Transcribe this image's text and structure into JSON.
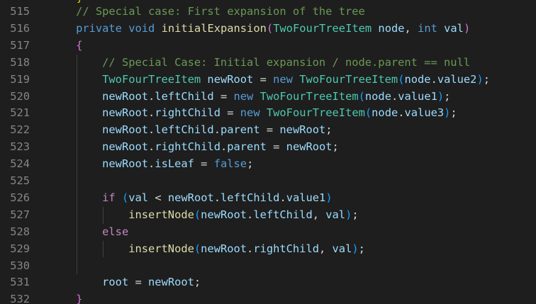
{
  "editor": {
    "theme_colors": {
      "background": "#1e1e1e",
      "line_number": "#858585",
      "comment": "#6a9955",
      "keyword": "#569cd6",
      "control": "#c586c0",
      "type": "#4ec9b0",
      "function": "#dcdcaa",
      "variable": "#9cdcfe",
      "text": "#d4d4d4"
    },
    "lines": [
      {
        "number": "515",
        "indent": "    ",
        "tokens": [
          {
            "t": "// Special case: First expansion of the tree",
            "c": "comment"
          }
        ]
      },
      {
        "number": "516",
        "indent": "    ",
        "tokens": [
          {
            "t": "private",
            "c": "keyword"
          },
          {
            "t": " ",
            "c": "plain"
          },
          {
            "t": "void",
            "c": "keyword"
          },
          {
            "t": " ",
            "c": "plain"
          },
          {
            "t": "initialExpansion",
            "c": "func"
          },
          {
            "t": "(",
            "c": "brace"
          },
          {
            "t": "TwoFourTreeItem",
            "c": "type"
          },
          {
            "t": " ",
            "c": "plain"
          },
          {
            "t": "node",
            "c": "var"
          },
          {
            "t": ", ",
            "c": "plain"
          },
          {
            "t": "int",
            "c": "keyword"
          },
          {
            "t": " ",
            "c": "plain"
          },
          {
            "t": "val",
            "c": "var"
          },
          {
            "t": ")",
            "c": "brace"
          }
        ]
      },
      {
        "number": "517",
        "indent": "    ",
        "tokens": [
          {
            "t": "{",
            "c": "brace"
          }
        ]
      },
      {
        "number": "518",
        "indent": "        ",
        "tokens": [
          {
            "t": "// Special Case: Initial expansion / node.parent == null",
            "c": "comment"
          }
        ]
      },
      {
        "number": "519",
        "indent": "        ",
        "tokens": [
          {
            "t": "TwoFourTreeItem",
            "c": "type"
          },
          {
            "t": " ",
            "c": "plain"
          },
          {
            "t": "newRoot",
            "c": "var"
          },
          {
            "t": " = ",
            "c": "plain"
          },
          {
            "t": "new",
            "c": "keyword"
          },
          {
            "t": " ",
            "c": "plain"
          },
          {
            "t": "TwoFourTreeItem",
            "c": "type"
          },
          {
            "t": "(",
            "c": "brace2"
          },
          {
            "t": "node",
            "c": "var"
          },
          {
            "t": ".",
            "c": "plain"
          },
          {
            "t": "value2",
            "c": "var"
          },
          {
            "t": ")",
            "c": "brace2"
          },
          {
            "t": ";",
            "c": "plain"
          }
        ]
      },
      {
        "number": "520",
        "indent": "        ",
        "tokens": [
          {
            "t": "newRoot",
            "c": "var"
          },
          {
            "t": ".",
            "c": "plain"
          },
          {
            "t": "leftChild",
            "c": "var"
          },
          {
            "t": " = ",
            "c": "plain"
          },
          {
            "t": "new",
            "c": "keyword"
          },
          {
            "t": " ",
            "c": "plain"
          },
          {
            "t": "TwoFourTreeItem",
            "c": "type"
          },
          {
            "t": "(",
            "c": "brace2"
          },
          {
            "t": "node",
            "c": "var"
          },
          {
            "t": ".",
            "c": "plain"
          },
          {
            "t": "value1",
            "c": "var"
          },
          {
            "t": ")",
            "c": "brace2"
          },
          {
            "t": ";",
            "c": "plain"
          }
        ]
      },
      {
        "number": "521",
        "indent": "        ",
        "tokens": [
          {
            "t": "newRoot",
            "c": "var"
          },
          {
            "t": ".",
            "c": "plain"
          },
          {
            "t": "rightChild",
            "c": "var"
          },
          {
            "t": " = ",
            "c": "plain"
          },
          {
            "t": "new",
            "c": "keyword"
          },
          {
            "t": " ",
            "c": "plain"
          },
          {
            "t": "TwoFourTreeItem",
            "c": "type"
          },
          {
            "t": "(",
            "c": "brace2"
          },
          {
            "t": "node",
            "c": "var"
          },
          {
            "t": ".",
            "c": "plain"
          },
          {
            "t": "value3",
            "c": "var"
          },
          {
            "t": ")",
            "c": "brace2"
          },
          {
            "t": ";",
            "c": "plain"
          }
        ]
      },
      {
        "number": "522",
        "indent": "        ",
        "tokens": [
          {
            "t": "newRoot",
            "c": "var"
          },
          {
            "t": ".",
            "c": "plain"
          },
          {
            "t": "leftChild",
            "c": "var"
          },
          {
            "t": ".",
            "c": "plain"
          },
          {
            "t": "parent",
            "c": "var"
          },
          {
            "t": " = ",
            "c": "plain"
          },
          {
            "t": "newRoot",
            "c": "var"
          },
          {
            "t": ";",
            "c": "plain"
          }
        ]
      },
      {
        "number": "523",
        "indent": "        ",
        "tokens": [
          {
            "t": "newRoot",
            "c": "var"
          },
          {
            "t": ".",
            "c": "plain"
          },
          {
            "t": "rightChild",
            "c": "var"
          },
          {
            "t": ".",
            "c": "plain"
          },
          {
            "t": "parent",
            "c": "var"
          },
          {
            "t": " = ",
            "c": "plain"
          },
          {
            "t": "newRoot",
            "c": "var"
          },
          {
            "t": ";",
            "c": "plain"
          }
        ]
      },
      {
        "number": "524",
        "indent": "        ",
        "tokens": [
          {
            "t": "newRoot",
            "c": "var"
          },
          {
            "t": ".",
            "c": "plain"
          },
          {
            "t": "isLeaf",
            "c": "var"
          },
          {
            "t": " = ",
            "c": "plain"
          },
          {
            "t": "false",
            "c": "keyword"
          },
          {
            "t": ";",
            "c": "plain"
          }
        ]
      },
      {
        "number": "525",
        "indent": "",
        "tokens": []
      },
      {
        "number": "526",
        "indent": "        ",
        "tokens": [
          {
            "t": "if",
            "c": "control"
          },
          {
            "t": " ",
            "c": "plain"
          },
          {
            "t": "(",
            "c": "brace2"
          },
          {
            "t": "val",
            "c": "var"
          },
          {
            "t": " < ",
            "c": "plain"
          },
          {
            "t": "newRoot",
            "c": "var"
          },
          {
            "t": ".",
            "c": "plain"
          },
          {
            "t": "leftChild",
            "c": "var"
          },
          {
            "t": ".",
            "c": "plain"
          },
          {
            "t": "value1",
            "c": "var"
          },
          {
            "t": ")",
            "c": "brace2"
          }
        ]
      },
      {
        "number": "527",
        "indent": "            ",
        "tokens": [
          {
            "t": "insertNode",
            "c": "func"
          },
          {
            "t": "(",
            "c": "brace2"
          },
          {
            "t": "newRoot",
            "c": "var"
          },
          {
            "t": ".",
            "c": "plain"
          },
          {
            "t": "leftChild",
            "c": "var"
          },
          {
            "t": ", ",
            "c": "plain"
          },
          {
            "t": "val",
            "c": "var"
          },
          {
            "t": ")",
            "c": "brace2"
          },
          {
            "t": ";",
            "c": "plain"
          }
        ]
      },
      {
        "number": "528",
        "indent": "        ",
        "tokens": [
          {
            "t": "else",
            "c": "control"
          }
        ]
      },
      {
        "number": "529",
        "indent": "            ",
        "tokens": [
          {
            "t": "insertNode",
            "c": "func"
          },
          {
            "t": "(",
            "c": "brace2"
          },
          {
            "t": "newRoot",
            "c": "var"
          },
          {
            "t": ".",
            "c": "plain"
          },
          {
            "t": "rightChild",
            "c": "var"
          },
          {
            "t": ", ",
            "c": "plain"
          },
          {
            "t": "val",
            "c": "var"
          },
          {
            "t": ")",
            "c": "brace2"
          },
          {
            "t": ";",
            "c": "plain"
          }
        ]
      },
      {
        "number": "530",
        "indent": "",
        "tokens": []
      },
      {
        "number": "531",
        "indent": "        ",
        "tokens": [
          {
            "t": "root",
            "c": "var"
          },
          {
            "t": " = ",
            "c": "plain"
          },
          {
            "t": "newRoot",
            "c": "var"
          },
          {
            "t": ";",
            "c": "plain"
          }
        ]
      },
      {
        "number": "532",
        "indent": "    ",
        "tokens": [
          {
            "t": "}",
            "c": "brace"
          }
        ]
      }
    ]
  }
}
